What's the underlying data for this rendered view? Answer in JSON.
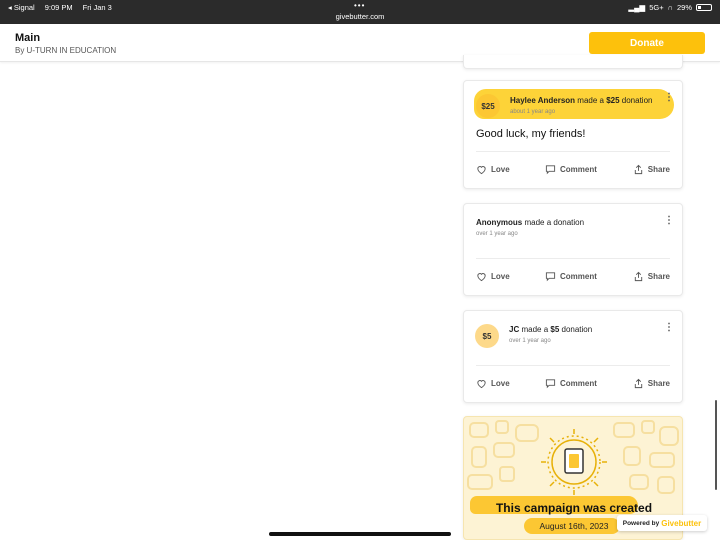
{
  "status_bar": {
    "back_app": "◂ Signal",
    "time": "9:09 PM",
    "date": "Fri Jan 3",
    "url": "givebutter.com",
    "network": "5G+",
    "battery": "29%"
  },
  "header": {
    "title": "Main",
    "subtitle": "By U-TURN IN EDUCATION",
    "donate_label": "Donate"
  },
  "feed": [
    {
      "amount_badge": "$25",
      "name": "Haylee Anderson",
      "made_text": " made a ",
      "amount": "$25",
      "suffix": " donation",
      "time": "about 1 year ago",
      "message": "Good luck, my friends!"
    },
    {
      "name": "Anonymous",
      "made_text": " made a donation",
      "time": "over 1 year ago"
    },
    {
      "amount_badge": "$5",
      "name": "JC",
      "made_text": " made a ",
      "amount": "$5",
      "suffix": " donation",
      "time": "over 1 year ago"
    }
  ],
  "actions": {
    "love": "Love",
    "comment": "Comment",
    "share": "Share"
  },
  "campaign_created": {
    "title": "This campaign was created",
    "date": "August 16th, 2023"
  },
  "powered_by": {
    "prefix": "Powered by",
    "brand": "Givebutter"
  },
  "colors": {
    "accent": "#fdc10c",
    "highlight": "#fcc733",
    "badge": "#fdd98a"
  }
}
